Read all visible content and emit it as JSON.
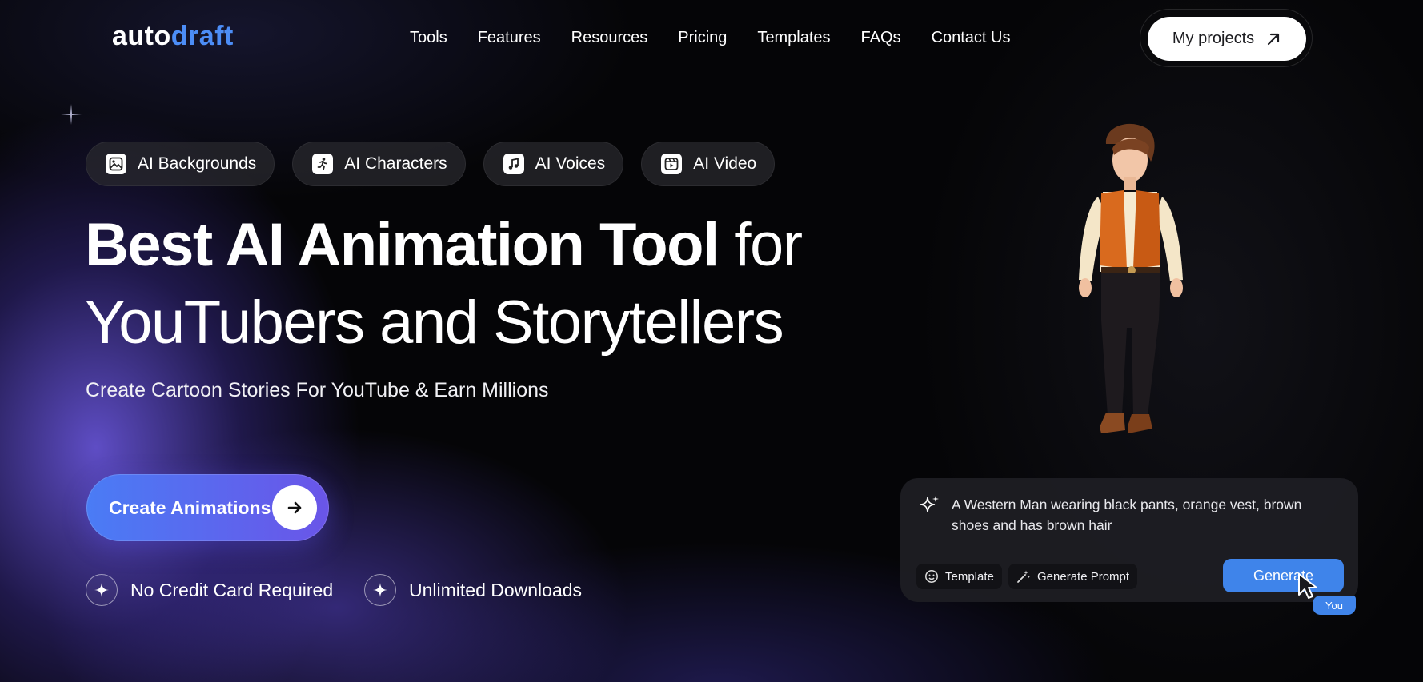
{
  "logo": {
    "part1": "auto",
    "part2": "draft"
  },
  "nav": {
    "items": [
      "Tools",
      "Features",
      "Resources",
      "Pricing",
      "Templates",
      "FAQs",
      "Contact Us"
    ]
  },
  "header": {
    "projects_label": "My projects"
  },
  "pills": [
    {
      "label": "AI Backgrounds",
      "icon": "image-icon"
    },
    {
      "label": "AI Characters",
      "icon": "running-person-icon"
    },
    {
      "label": "AI Voices",
      "icon": "music-note-icon"
    },
    {
      "label": "AI Video",
      "icon": "video-icon"
    }
  ],
  "hero": {
    "headline_bold": "Best AI Animation Tool",
    "headline_light_1": "for",
    "headline_light_2": "YouTubers and Storytellers",
    "subheadline": "Create Cartoon Stories For YouTube & Earn Millions",
    "cta_label": "Create Animations"
  },
  "features": [
    "No Credit Card Required",
    "Unlimited Downloads"
  ],
  "prompt": {
    "text": "A Western Man wearing black pants, orange vest, brown shoes and has brown hair",
    "template_label": "Template",
    "generate_prompt_label": "Generate Prompt",
    "generate_label": "Generate",
    "cursor_tag": "You"
  },
  "colors": {
    "accent": "#4c8df6",
    "generate": "#3f84ea",
    "cta_start": "#4a7cf5",
    "cta_end": "#6a55e8"
  }
}
